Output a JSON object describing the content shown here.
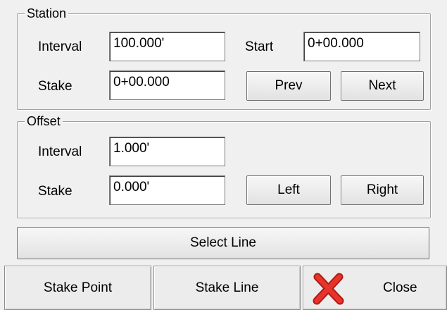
{
  "station": {
    "title": "Station",
    "interval_label": "Interval",
    "interval_value": "100.000'",
    "start_label": "Start",
    "start_value": "0+00.000",
    "stake_label": "Stake",
    "stake_value": "0+00.000",
    "prev_label": "Prev",
    "next_label": "Next"
  },
  "offset": {
    "title": "Offset",
    "interval_label": "Interval",
    "interval_value": "1.000'",
    "stake_label": "Stake",
    "stake_value": "0.000'",
    "left_label": "Left",
    "right_label": "Right"
  },
  "select_line_label": "Select Line",
  "bottom": {
    "stake_point_label": "Stake Point",
    "stake_line_label": "Stake Line",
    "close_label": "Close"
  },
  "colors": {
    "close_icon": "#e8332b"
  }
}
